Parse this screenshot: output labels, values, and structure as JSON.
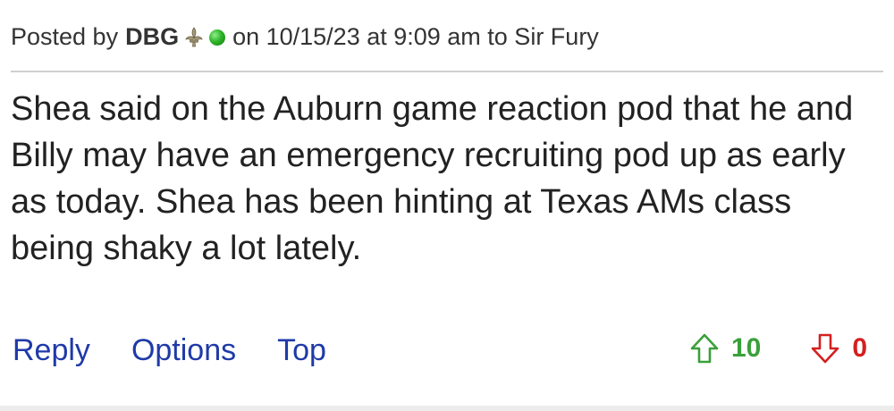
{
  "header": {
    "prefix": "Posted by",
    "author": "DBG",
    "meta": "on 10/15/23 at 9:09 am to Sir Fury",
    "icons": [
      "fleur-de-lis-icon",
      "online-status-icon"
    ]
  },
  "body": {
    "text": "Shea said on the Auburn game reaction pod that he and Billy may have an emergency recruiting pod up as early as today. Shea has been hinting at Texas AMs class being shaky a lot lately."
  },
  "actions": {
    "reply": "Reply",
    "options": "Options",
    "top": "Top"
  },
  "votes": {
    "up_count": "10",
    "down_count": "0",
    "up_color": "#3aa03a",
    "down_color": "#d42020"
  }
}
